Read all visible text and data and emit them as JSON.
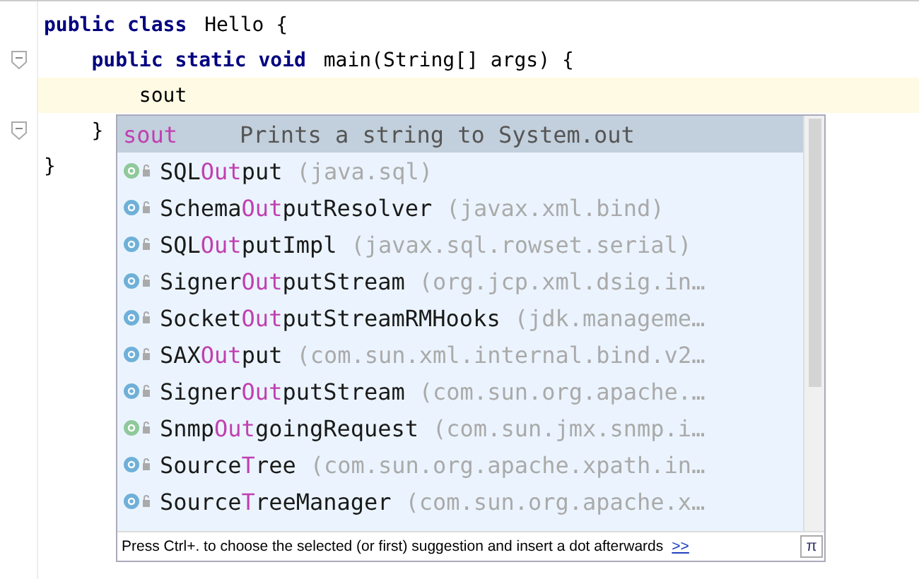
{
  "editor": {
    "lines": [
      {
        "parts": [
          {
            "text": "public class ",
            "kind": "keyword"
          },
          {
            "text": "Hello {",
            "kind": "plain"
          }
        ],
        "current": false,
        "fold": false
      },
      {
        "parts": [
          {
            "text": "    public static void ",
            "kind": "keyword"
          },
          {
            "text": "main(String[] args) {",
            "kind": "plain"
          }
        ],
        "current": false,
        "fold": true
      },
      {
        "parts": [
          {
            "text": "        sout",
            "kind": "plain"
          }
        ],
        "current": true,
        "fold": false
      },
      {
        "parts": [
          {
            "text": "    }",
            "kind": "plain"
          }
        ],
        "current": false,
        "fold": true
      },
      {
        "parts": [
          {
            "text": "}",
            "kind": "plain"
          }
        ],
        "current": false,
        "fold": false
      }
    ]
  },
  "completion": {
    "items": [
      {
        "kind": "template",
        "name_parts": [
          {
            "text": "sout",
            "match": true
          }
        ],
        "detail": "Prints a string to System.out",
        "selected": true
      },
      {
        "kind": "interface",
        "name_parts": [
          {
            "text": "SQL",
            "match": false
          },
          {
            "text": "Out",
            "match": true
          },
          {
            "text": "put",
            "match": false
          }
        ],
        "detail": "(java.sql)",
        "selected": false
      },
      {
        "kind": "class",
        "name_parts": [
          {
            "text": "Schema",
            "match": false
          },
          {
            "text": "Out",
            "match": true
          },
          {
            "text": "putResolver",
            "match": false
          }
        ],
        "detail": "(javax.xml.bind)",
        "selected": false
      },
      {
        "kind": "class",
        "name_parts": [
          {
            "text": "SQL",
            "match": false
          },
          {
            "text": "Out",
            "match": true
          },
          {
            "text": "putImpl",
            "match": false
          }
        ],
        "detail": "(javax.sql.rowset.serial)",
        "selected": false
      },
      {
        "kind": "class",
        "name_parts": [
          {
            "text": "Signer",
            "match": false
          },
          {
            "text": "Out",
            "match": true
          },
          {
            "text": "putStream",
            "match": false
          }
        ],
        "detail": "(org.jcp.xml.dsig.in…",
        "selected": false
      },
      {
        "kind": "class",
        "name_parts": [
          {
            "text": "Socket",
            "match": false
          },
          {
            "text": "Out",
            "match": true
          },
          {
            "text": "putStreamRMHooks",
            "match": false
          }
        ],
        "detail": "(jdk.manageme…",
        "selected": false
      },
      {
        "kind": "class",
        "name_parts": [
          {
            "text": "SAX",
            "match": false
          },
          {
            "text": "Out",
            "match": true
          },
          {
            "text": "put",
            "match": false
          }
        ],
        "detail": "(com.sun.xml.internal.bind.v2…",
        "selected": false
      },
      {
        "kind": "class",
        "name_parts": [
          {
            "text": "Signer",
            "match": false
          },
          {
            "text": "Out",
            "match": true
          },
          {
            "text": "putStream",
            "match": false
          }
        ],
        "detail": "(com.sun.org.apache.…",
        "selected": false
      },
      {
        "kind": "interface",
        "name_parts": [
          {
            "text": "Snmp",
            "match": false
          },
          {
            "text": "Out",
            "match": true
          },
          {
            "text": "goingRequest",
            "match": false
          }
        ],
        "detail": "(com.sun.jmx.snmp.i…",
        "selected": false
      },
      {
        "kind": "class",
        "name_parts": [
          {
            "text": "Source",
            "match": false
          },
          {
            "text": "T",
            "match": true
          },
          {
            "text": "ree",
            "match": false
          }
        ],
        "detail": "(com.sun.org.apache.xpath.in…",
        "selected": false
      },
      {
        "kind": "class",
        "name_parts": [
          {
            "text": "Source",
            "match": false
          },
          {
            "text": "T",
            "match": true
          },
          {
            "text": "reeManager",
            "match": false
          }
        ],
        "detail": "(com.sun.org.apache.x…",
        "selected": false
      }
    ],
    "hint": "Press Ctrl+. to choose the selected (or first) suggestion and insert a dot afterwards",
    "hint_link": ">>",
    "pi_button": "π"
  }
}
